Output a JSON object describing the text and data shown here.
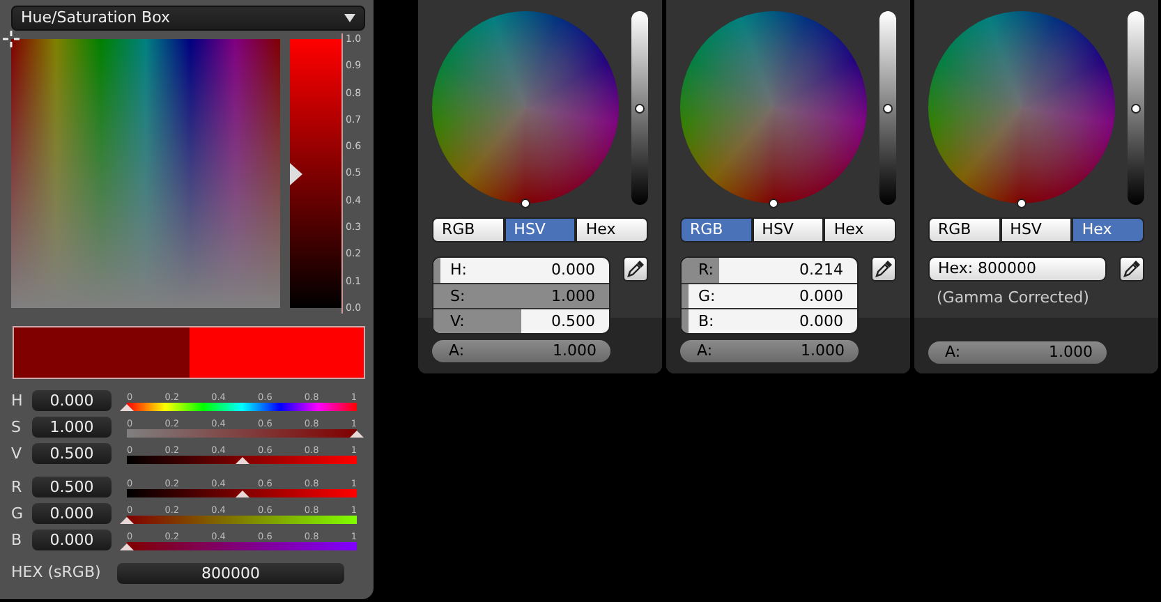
{
  "picker": {
    "mode_dropdown": "Hue/Saturation Box",
    "value_bar": {
      "level": 0.5
    },
    "value_scale": [
      "1.0",
      "0.9",
      "0.8",
      "0.7",
      "0.6",
      "0.5",
      "0.4",
      "0.3",
      "0.2",
      "0.1",
      "0.0"
    ],
    "swatches": [
      {
        "color": "#800000"
      },
      {
        "color": "#ff0000"
      }
    ],
    "sliders": [
      {
        "kind": "hue",
        "label": "H",
        "value": "0.000",
        "level": 0,
        "ticks": [
          "0",
          "0.2",
          "0.4",
          "0.6",
          "0.8",
          "1"
        ]
      },
      {
        "kind": "saturation",
        "label": "S",
        "value": "1.000",
        "level": 1,
        "ticks": [
          "0",
          "0.2",
          "0.4",
          "0.6",
          "0.8",
          "1"
        ]
      },
      {
        "kind": "value",
        "label": "V",
        "value": "0.500",
        "level": 0.5,
        "ticks": [
          "0",
          "0.2",
          "0.4",
          "0.6",
          "0.8",
          "1"
        ]
      },
      {
        "kind": "red",
        "label": "R",
        "value": "0.500",
        "level": 0.5,
        "ticks": [
          "0",
          "0.2",
          "0.4",
          "0.6",
          "0.8",
          "1"
        ]
      },
      {
        "kind": "green",
        "label": "G",
        "value": "0.000",
        "level": 0,
        "ticks": [
          "0",
          "0.2",
          "0.4",
          "0.6",
          "0.8",
          "1"
        ]
      },
      {
        "kind": "blue",
        "label": "B",
        "value": "0.000",
        "level": 0,
        "ticks": [
          "0",
          "0.2",
          "0.4",
          "0.6",
          "0.8",
          "1"
        ]
      }
    ],
    "hex_label": "HEX (sRGB)",
    "hex_value": "800000"
  },
  "wheel_popups": [
    {
      "kind": "fields",
      "value_slider": {
        "level": 0.5
      },
      "tabs": [
        {
          "label": "RGB",
          "selected": false
        },
        {
          "label": "HSV",
          "selected": true
        },
        {
          "label": "Hex",
          "selected": false
        }
      ],
      "fields": [
        {
          "label": "H:",
          "value": "0.000",
          "level": 0
        },
        {
          "label": "S:",
          "value": "1.000",
          "level": 1
        },
        {
          "label": "V:",
          "value": "0.500",
          "level": 0.5
        }
      ],
      "alpha": {
        "label": "A:",
        "value": "1.000"
      }
    },
    {
      "kind": "fields",
      "value_slider": {
        "level": 0.5
      },
      "tabs": [
        {
          "label": "RGB",
          "selected": true
        },
        {
          "label": "HSV",
          "selected": false
        },
        {
          "label": "Hex",
          "selected": false
        }
      ],
      "fields": [
        {
          "label": "R:",
          "value": "0.214",
          "level": 0.214
        },
        {
          "label": "G:",
          "value": "0.000",
          "level": 0
        },
        {
          "label": "B:",
          "value": "0.000",
          "level": 0
        }
      ],
      "alpha": {
        "label": "A:",
        "value": "1.000"
      }
    },
    {
      "kind": "hex",
      "value_slider": {
        "level": 0.5
      },
      "tabs": [
        {
          "label": "RGB",
          "selected": false
        },
        {
          "label": "HSV",
          "selected": false
        },
        {
          "label": "Hex",
          "selected": true
        }
      ],
      "hex_field": "Hex: 800000",
      "note": "(Gamma Corrected)",
      "alpha": {
        "label": "A:",
        "value": "1.000"
      }
    }
  ]
}
